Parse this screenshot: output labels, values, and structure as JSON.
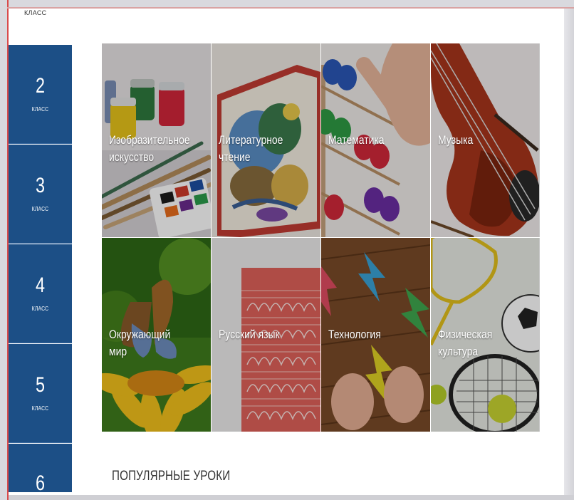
{
  "top_caption": "КЛАСС",
  "grades": [
    {
      "number": "2",
      "label": "КЛАСС"
    },
    {
      "number": "3",
      "label": "КЛАСС"
    },
    {
      "number": "4",
      "label": "КЛАСС"
    },
    {
      "number": "5",
      "label": "КЛАСС"
    },
    {
      "number": "6",
      "label": ""
    }
  ],
  "subjects": [
    {
      "title": "Изобразительное\nискусство",
      "image": "paints-brushes"
    },
    {
      "title": "Литературное\nчтение",
      "image": "storybook"
    },
    {
      "title": "Математика",
      "image": "abacus"
    },
    {
      "title": "Музыка",
      "image": "violin"
    },
    {
      "title": "Окружающий мир",
      "image": "butterfly-flower"
    },
    {
      "title": "Русский язык",
      "image": "handwriting"
    },
    {
      "title": "Технология",
      "image": "paper-craft"
    },
    {
      "title": "Физическая\nкультура",
      "image": "sports-equipment"
    }
  ],
  "section_title": "ПОПУЛЯРНЫЕ УРОКИ",
  "colors": {
    "sidebar": "#1c4f86",
    "page_background": "#ffffff",
    "frame_accent": "#d94b4b"
  }
}
